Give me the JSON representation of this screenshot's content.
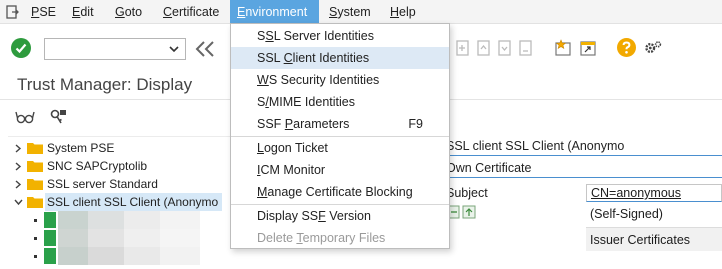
{
  "menubar": {
    "items": [
      {
        "label": "PSE",
        "mnemonic": "P",
        "rest": "SE"
      },
      {
        "label": "Edit",
        "mnemonic": "E",
        "rest": "dit"
      },
      {
        "label": "Goto",
        "mnemonic": "G",
        "rest": "oto"
      },
      {
        "label": "Certificate",
        "mnemonic": "C",
        "rest": "ertificate"
      },
      {
        "label": "Environment",
        "mnemonic": "E",
        "rest": "nvironment"
      },
      {
        "label": "System",
        "mnemonic": "S",
        "rest": "ystem"
      },
      {
        "label": "Help",
        "mnemonic": "H",
        "rest": "elp"
      }
    ],
    "active_index": 4
  },
  "toolbar": {
    "command_field_value": ""
  },
  "page": {
    "title": "Trust Manager: Display"
  },
  "dropdown": {
    "items": [
      {
        "pre": "S",
        "mn": "S",
        "post": "L Server Identities",
        "label": "SSL Server Identities",
        "disabled": false
      },
      {
        "pre": "SSL ",
        "mn": "C",
        "post": "lient Identities",
        "label": "SSL Client Identities",
        "disabled": false,
        "hover": true
      },
      {
        "pre": "",
        "mn": "W",
        "post": "S Security Identities",
        "label": "WS Security Identities",
        "disabled": false
      },
      {
        "pre": "S",
        "mn": "/",
        "post": "MIME Identities",
        "label": "S/MIME Identities",
        "disabled": false
      },
      {
        "pre": "SSF ",
        "mn": "P",
        "post": "arameters",
        "label": "SSF Parameters",
        "accelerator": "F9",
        "disabled": false
      },
      {
        "pre": "",
        "mn": "L",
        "post": "ogon Ticket",
        "label": "Logon Ticket",
        "disabled": false
      },
      {
        "pre": "",
        "mn": "I",
        "post": "CM Monitor",
        "label": "ICM Monitor",
        "disabled": false
      },
      {
        "pre": "",
        "mn": "M",
        "post": "anage Certificate Blocking",
        "label": "Manage Certificate Blocking",
        "disabled": false
      },
      {
        "pre": "Display SS",
        "mn": "F",
        "post": " Version",
        "label": "Display SSF Version",
        "disabled": false
      },
      {
        "pre": "Delete ",
        "mn": "T",
        "post": "emporary Files",
        "label": "Delete Temporary Files",
        "disabled": true
      }
    ]
  },
  "tree": {
    "nodes": [
      {
        "label": "System PSE",
        "expanded": false
      },
      {
        "label": "SNC SAPCryptolib",
        "expanded": false
      },
      {
        "label": "SSL server Standard",
        "expanded": false
      },
      {
        "label": "SSL client SSL Client (Anonymo",
        "expanded": true,
        "selected": true
      }
    ]
  },
  "right_panel": {
    "pse_field": "SSL client SSL Client (Anonymo",
    "own_cert_header": "Own Certificate",
    "subject_label": "Subject",
    "subject_value": "CN=anonymous",
    "issuer_value": "(Self-Signed)",
    "issuer_certificates_label": "Issuer Certificates"
  },
  "colors": {
    "menu_active": "#5aa5e0",
    "hover_row": "#dde9f5",
    "selected_tree": "#d6e8f7",
    "ok_green": "#2e9b3e",
    "folder": "#f2b200",
    "key_green": "#2aa14a",
    "accent_line": "#4a8fcf"
  }
}
